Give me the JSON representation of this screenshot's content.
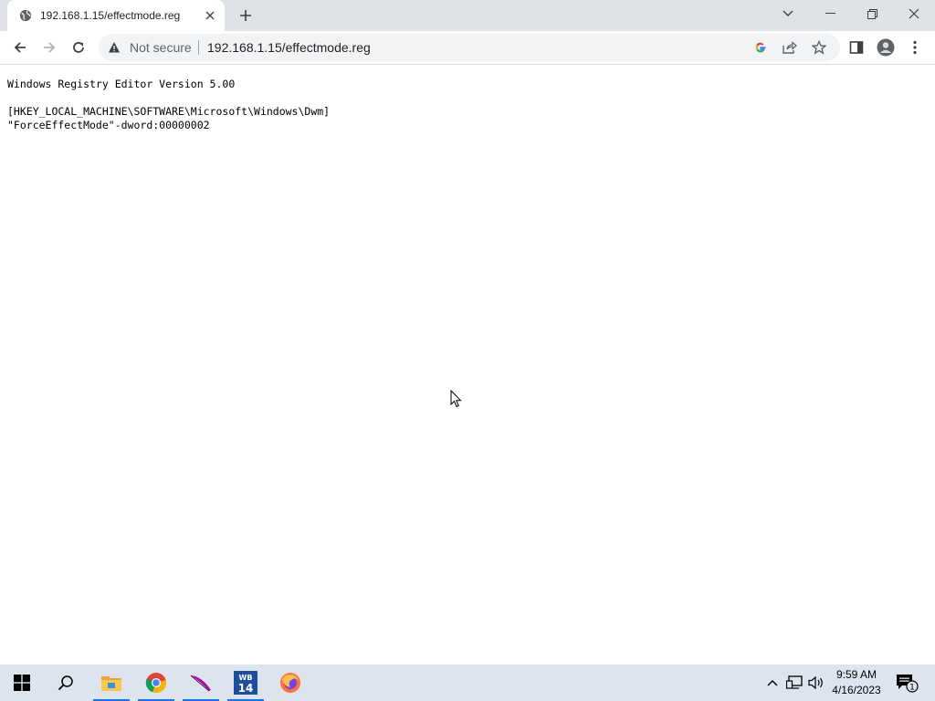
{
  "browser": {
    "tab_title": "192.168.1.15/effectmode.reg",
    "omnibox": {
      "security_label": "Not secure",
      "url": "192.168.1.15/effectmode.reg"
    }
  },
  "page": {
    "lines": [
      "Windows Registry Editor Version 5.00",
      "",
      "[HKEY_LOCAL_MACHINE\\SOFTWARE\\Microsoft\\Windows\\Dwm]",
      "\"ForceEffectMode\"-dword:00000002"
    ]
  },
  "taskbar": {
    "apps": [
      "start",
      "search",
      "file-explorer",
      "chrome",
      "feather-app",
      "wb14-app",
      "firefox"
    ],
    "clock_time": "9:59 AM",
    "clock_date": "4/16/2023",
    "notification_count": "1",
    "wb_label": "WB",
    "wb_number": "14"
  },
  "colors": {
    "tab_strip": "#dee1e6",
    "omnibox": "#f1f3f4",
    "taskbar": "#dde4ee",
    "accent": "#1a73e8"
  }
}
